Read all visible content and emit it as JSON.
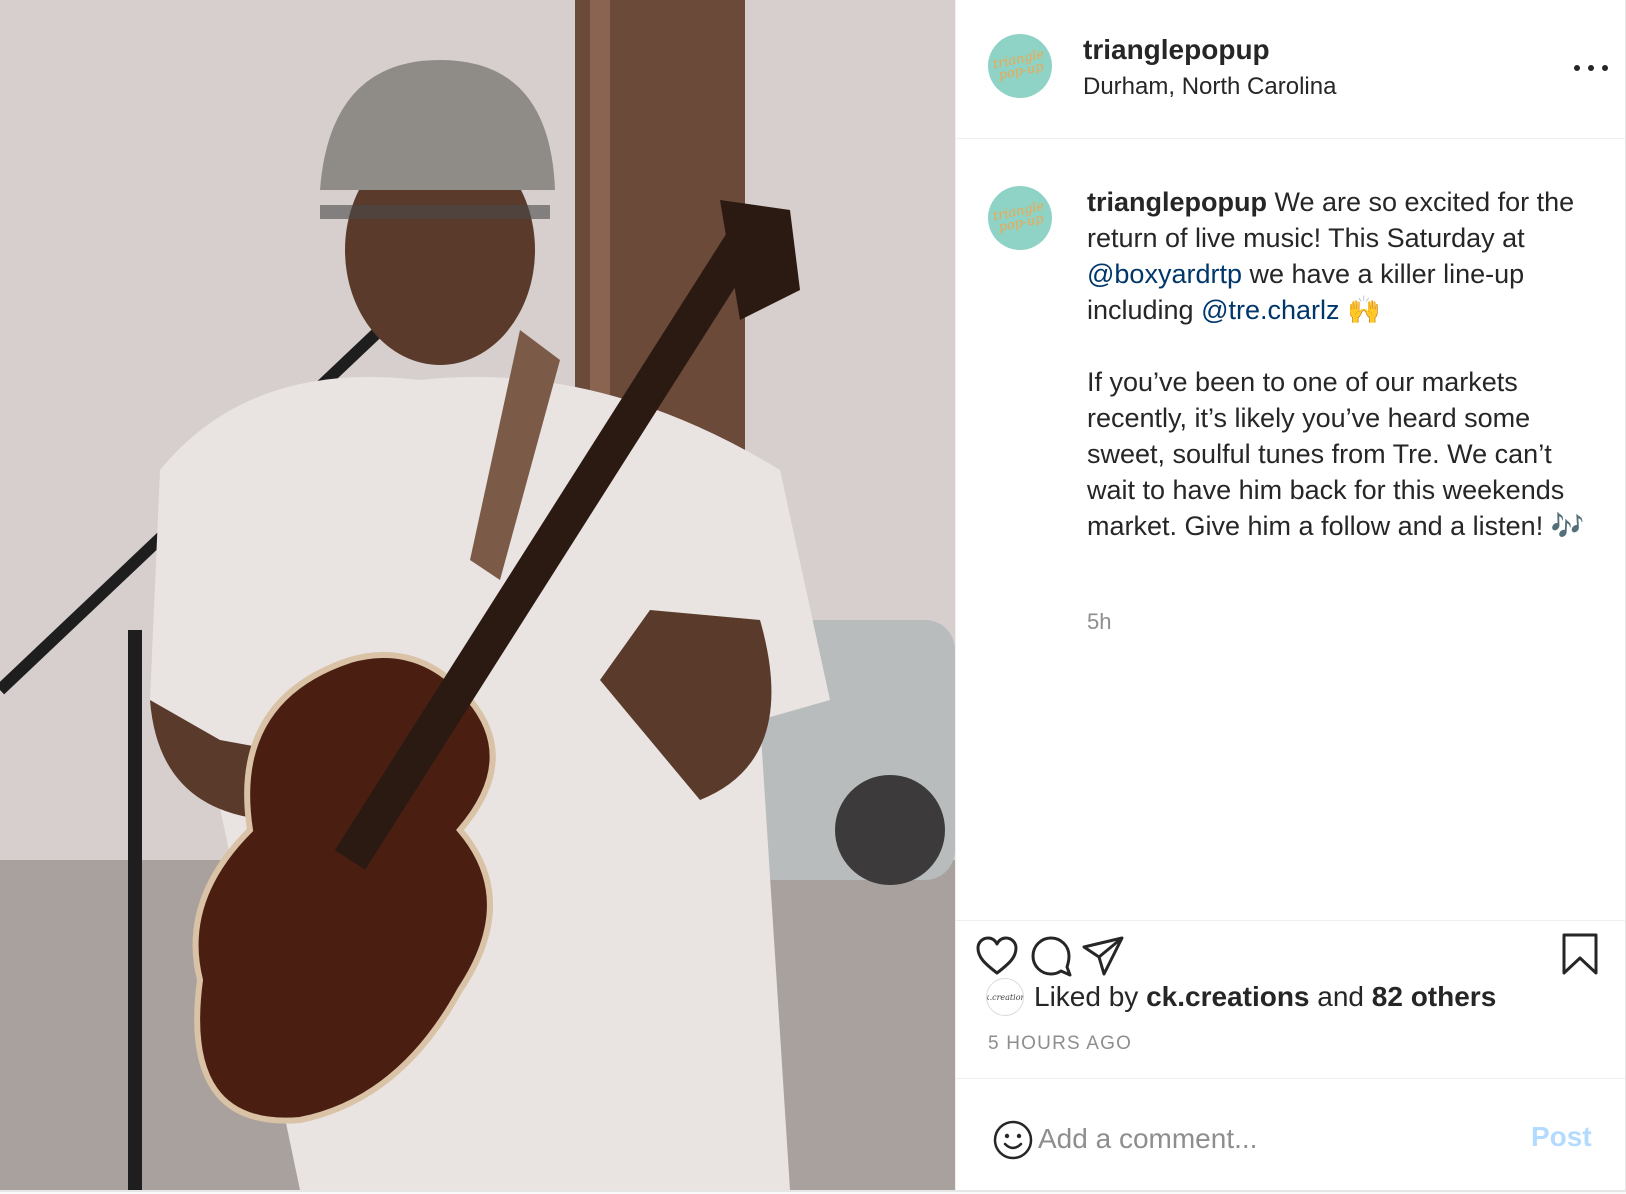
{
  "post": {
    "username": "trianglepopup",
    "location": "Durham, North Carolina",
    "avatar_text": "triangle pop-up",
    "caption_parts": [
      {
        "type": "user",
        "text": "trianglepopup"
      },
      {
        "type": "text",
        "text": " We are so excited for the return of live music! This Saturday at "
      },
      {
        "type": "mention",
        "text": "@boxyardrtp"
      },
      {
        "type": "text",
        "text": " we have a killer line-up including "
      },
      {
        "type": "mention",
        "text": "@tre.charlz"
      },
      {
        "type": "text",
        "text": " 🙌\n\nIf you’ve been to one of our markets recently, it’s likely you’ve heard some sweet, soulful tunes from Tre. We can’t wait to have him back for this weekends market. Give him a follow and a listen! 🎶"
      }
    ],
    "time_short": "5h",
    "likes": {
      "prefix": "Liked by",
      "user": "ck.creations",
      "conjunction": "and",
      "others": "82 others",
      "avatar_text": "ck.creations"
    },
    "time_long": "5 HOURS AGO"
  },
  "comment": {
    "placeholder": "Add a comment...",
    "post_label": "Post"
  },
  "icons": [
    "more-icon",
    "heart-icon",
    "comment-icon",
    "share-icon",
    "bookmark-icon",
    "smiley-icon"
  ],
  "colors": {
    "mention": "#00376b",
    "muted": "#8e8e8e",
    "post_disabled": "#b3dbff",
    "avatar_bg": "#8fd3c6"
  }
}
